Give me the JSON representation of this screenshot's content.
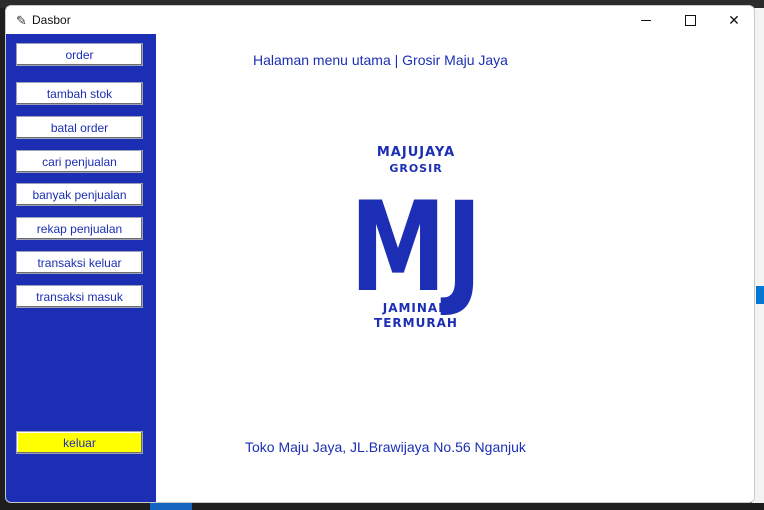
{
  "window": {
    "title": "Dasbor",
    "controls": {
      "minimize": "minimize-icon",
      "maximize": "maximize-icon",
      "close": "close-icon"
    }
  },
  "sidebar": {
    "items": [
      {
        "label": "order"
      },
      {
        "label": "tambah stok"
      },
      {
        "label": "batal order"
      },
      {
        "label": "cari penjualan"
      },
      {
        "label": "banyak penjualan"
      },
      {
        "label": "rekap penjualan"
      },
      {
        "label": "transaksi keluar"
      },
      {
        "label": "transaksi masuk"
      }
    ],
    "exit_label": "keluar"
  },
  "main": {
    "heading": "Halaman menu utama | Grosir Maju Jaya",
    "logo": {
      "line1": "MAJUJAYA",
      "line2": "GROSIR",
      "initials": "MJ",
      "line3": "JAMINAN",
      "line4": "TERMURAH"
    },
    "footer": "Toko Maju Jaya, JL.Brawijaya No.56 Nganjuk"
  },
  "colors": {
    "sidebar_bg": "#1c2fb4",
    "accent_text": "#1c2fb4",
    "exit_button": "#ffff00",
    "window_bg": "#ffffff"
  }
}
